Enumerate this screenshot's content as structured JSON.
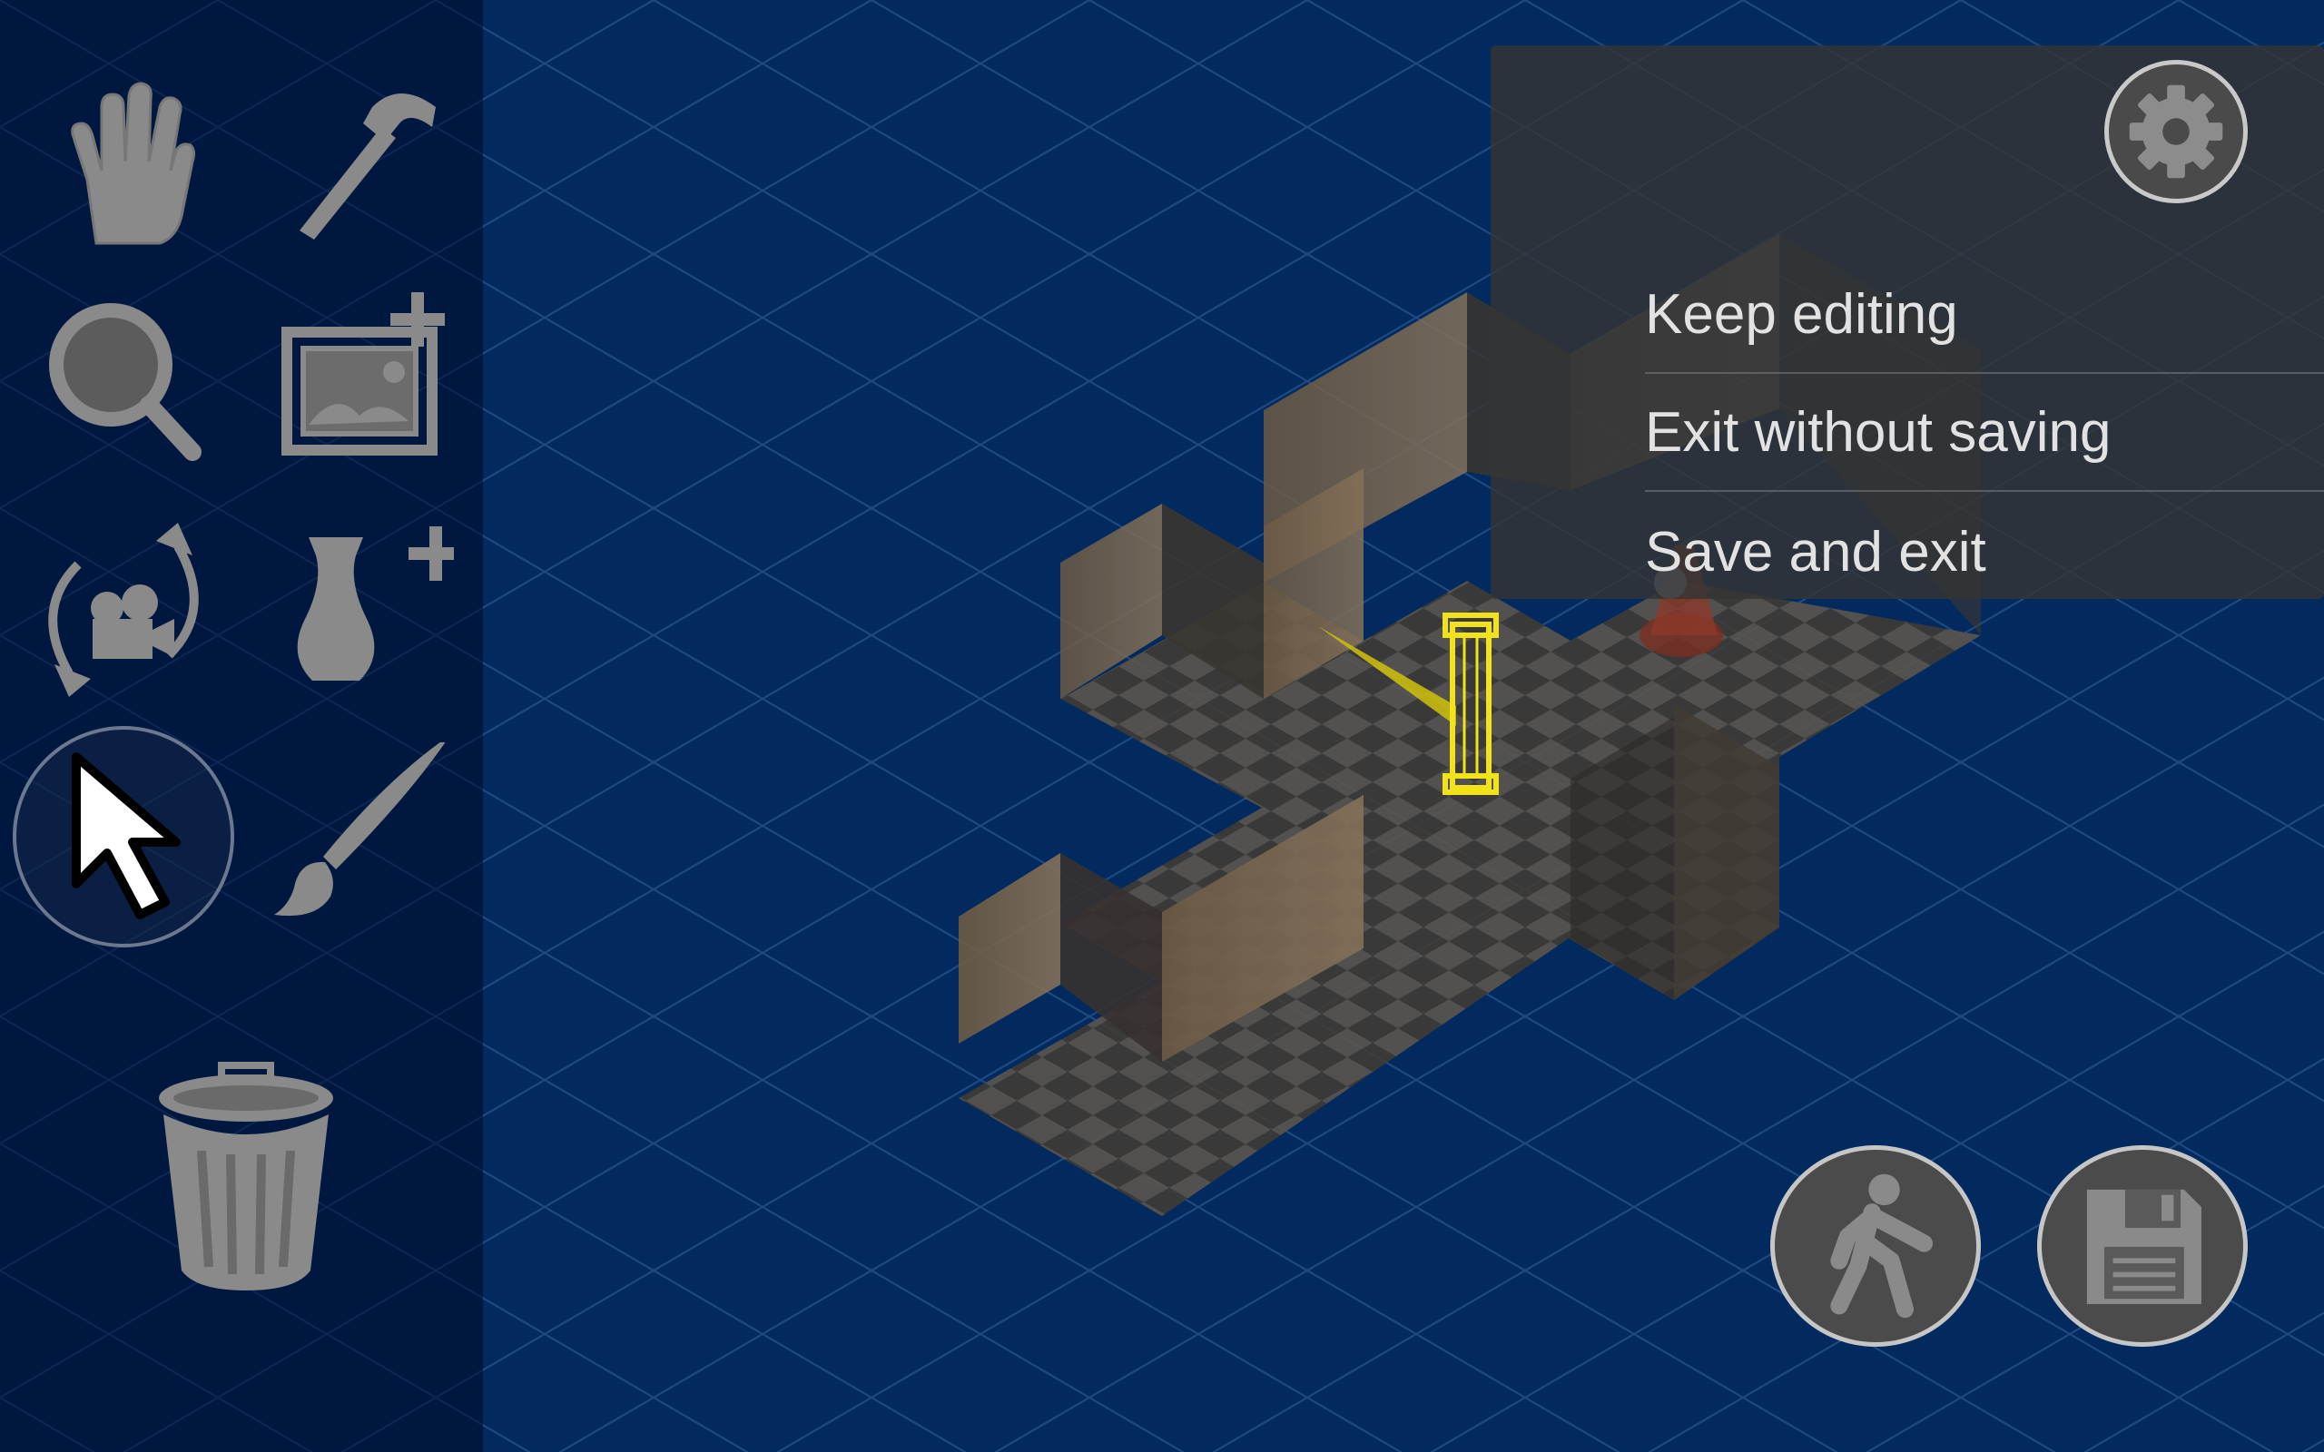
{
  "toolbar": {
    "tools": [
      {
        "icon": "hand-icon"
      },
      {
        "icon": "hammer-icon"
      },
      {
        "icon": "magnifier-icon"
      },
      {
        "icon": "add-image-icon"
      },
      {
        "icon": "rotate-camera-icon"
      },
      {
        "icon": "add-vase-icon"
      },
      {
        "icon": "cursor-icon",
        "selected": true
      },
      {
        "icon": "paintbrush-icon"
      },
      {
        "icon": "trash-icon"
      }
    ]
  },
  "menu": {
    "settings_icon": "gear-icon",
    "items": [
      "Keep editing",
      "Exit without saving",
      "Save and exit"
    ]
  },
  "actions": {
    "walk_icon": "walk-icon",
    "save_icon": "floppy-disk-icon"
  },
  "colors": {
    "background": "#022a5e",
    "icon_gray": "#8a8a8a",
    "highlight_yellow": "#f2e21a"
  }
}
